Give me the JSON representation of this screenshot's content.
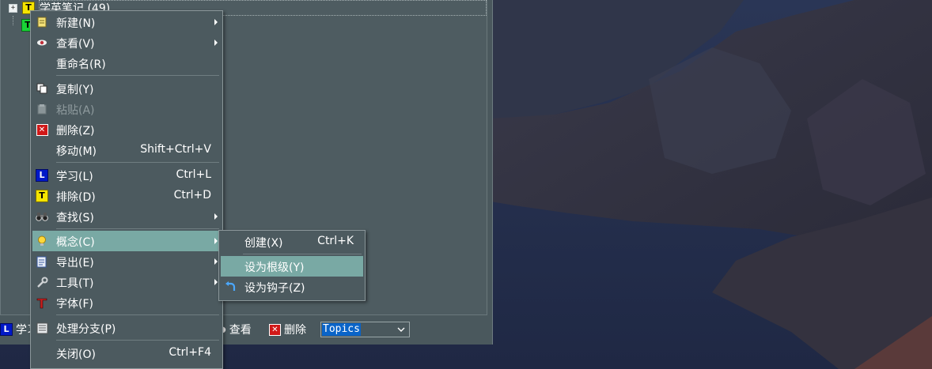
{
  "tree": {
    "root_label": "学英笔记 (49)",
    "root_badge": "T",
    "child_badge": "T"
  },
  "bottom_toolbar": {
    "learn_badge": "L",
    "learn_label": "学习",
    "view_label": "查看",
    "delete_label": "删除",
    "topics_value": "Topics"
  },
  "context_menu": {
    "items": [
      {
        "label": "新建(N)",
        "icon": "new-document-icon",
        "submenu": true
      },
      {
        "label": "查看(V)",
        "icon": "eye-icon",
        "submenu": true
      },
      {
        "label": "重命名(R)"
      },
      {
        "label": "复制(Y)",
        "icon": "copy-icon"
      },
      {
        "label": "粘贴(A)",
        "icon": "paste-icon",
        "disabled": true
      },
      {
        "label": "删除(Z)",
        "icon": "delete-icon"
      },
      {
        "label": "移动(M)",
        "shortcut": "Shift+Ctrl+V"
      },
      {
        "label": "学习(L)",
        "icon": "learn-badge-icon",
        "badge": "L",
        "shortcut": "Ctrl+L"
      },
      {
        "label": "排除(D)",
        "icon": "exclude-badge-icon",
        "badge": "T",
        "shortcut": "Ctrl+D"
      },
      {
        "label": "查找(S)",
        "icon": "binoculars-icon",
        "submenu": true
      },
      {
        "label": "概念(C)",
        "icon": "lightbulb-icon",
        "submenu": true,
        "highlighted": true
      },
      {
        "label": "导出(E)",
        "icon": "export-icon",
        "submenu": true
      },
      {
        "label": "工具(T)",
        "icon": "wrench-icon",
        "submenu": true
      },
      {
        "label": "字体(F)",
        "icon": "font-icon"
      },
      {
        "label": "处理分支(P)",
        "icon": "process-branch-icon"
      },
      {
        "label": "关闭(O)",
        "shortcut": "Ctrl+F4"
      }
    ]
  },
  "concept_submenu": {
    "items": [
      {
        "label": "创建(X)",
        "shortcut": "Ctrl+K"
      },
      {
        "label": "设为根级(Y)",
        "highlighted": true
      },
      {
        "label": "设为钩子(Z)",
        "icon": "hook-arrow-icon"
      }
    ]
  },
  "colors": {
    "menu_bg": "#4c5a5f",
    "menu_highlight": "#79a9a4",
    "window_bg": "#4a585d",
    "select_highlight": "#0a64c8"
  }
}
